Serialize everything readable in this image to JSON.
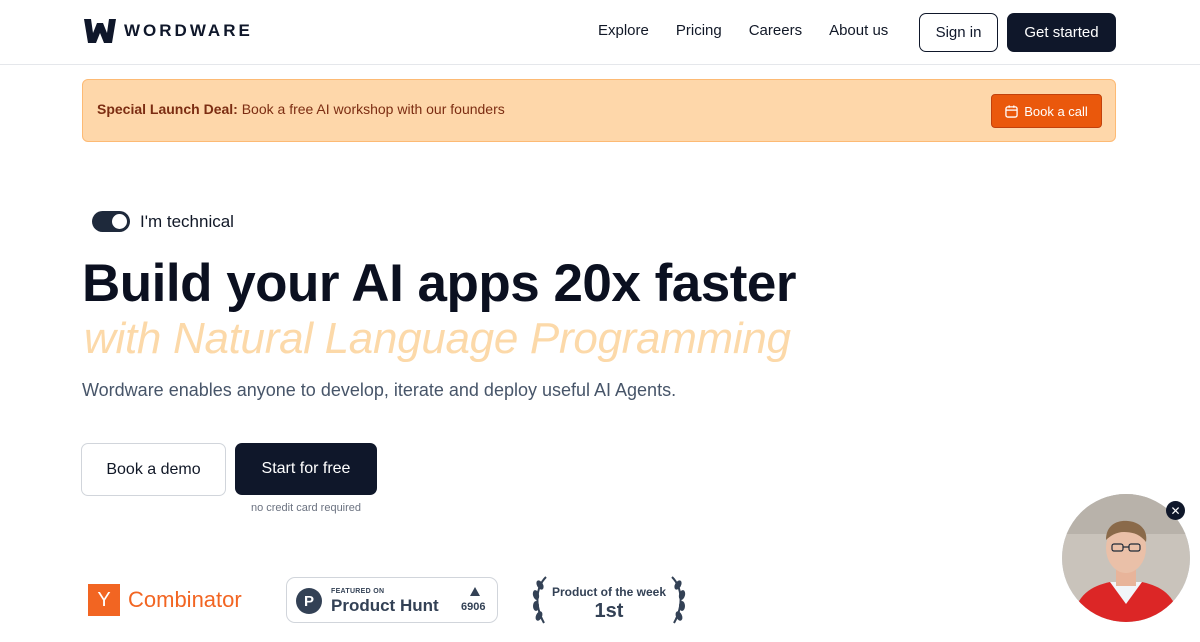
{
  "header": {
    "brand": "WORDWARE",
    "nav": [
      "Explore",
      "Pricing",
      "Careers",
      "About us"
    ],
    "sign_in": "Sign in",
    "get_started": "Get started"
  },
  "banner": {
    "bold": "Special Launch Deal:",
    "text": " Book a free AI workshop with our founders",
    "button": "Book a call"
  },
  "hero": {
    "toggle_label": "I'm technical",
    "toggle_on": true,
    "title": "Build your AI apps 20x faster",
    "subtitle": "with Natural Language Programming",
    "description": "Wordware enables anyone to develop, iterate and deploy useful AI Agents.",
    "book_demo": "Book a demo",
    "start_free": "Start for free",
    "note": "no credit card required"
  },
  "badges": {
    "yc_letter": "Y",
    "yc_text": "Combinator",
    "ph_small": "FEATURED ON",
    "ph_big": "Product Hunt",
    "ph_count": "6906",
    "ph_logo": "P",
    "potw_title": "Product of the week",
    "potw_rank": "1st"
  },
  "video": {
    "close_glyph": "✕"
  },
  "colors": {
    "primary": "#0f172a",
    "accent": "#ea580c",
    "banner_bg": "#fed7aa",
    "yc_orange": "#f26522"
  }
}
